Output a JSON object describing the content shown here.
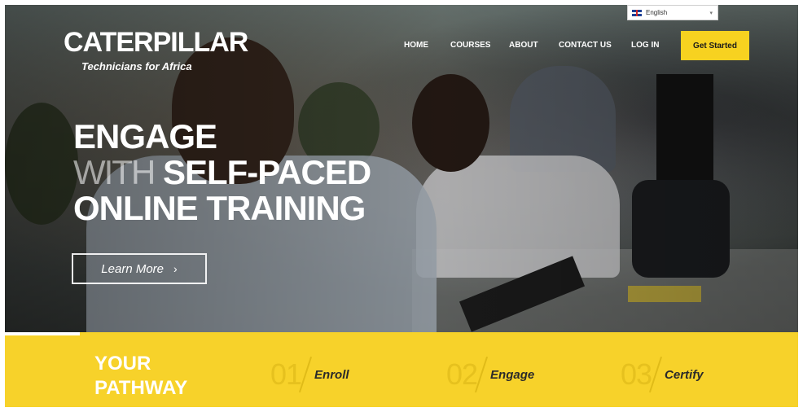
{
  "header": {
    "brand": "CATERPILLAR",
    "tagline": "Technicians for Africa",
    "language": {
      "selected": "English",
      "flag_icon": "uk-flag-icon"
    },
    "nav": [
      {
        "label": "HOME"
      },
      {
        "label": "COURSES"
      },
      {
        "label": "ABOUT"
      },
      {
        "label": "CONTACT US"
      },
      {
        "label": "LOG IN"
      }
    ],
    "cta_label": "Get Started"
  },
  "hero": {
    "line1": "ENGAGE",
    "line2_thin": "WITH",
    "line2_bold": "SELF-PACED",
    "line3": "ONLINE TRAINING",
    "button_label": "Learn More",
    "button_icon": "chevron-right-icon"
  },
  "pathway": {
    "title_line1": "YOUR",
    "title_line2": "PATHWAY",
    "steps": [
      {
        "number": "01",
        "label": "Enroll"
      },
      {
        "number": "02",
        "label": "Engage"
      },
      {
        "number": "03",
        "label": "Certify"
      }
    ]
  },
  "colors": {
    "accent_yellow": "#f7d22a",
    "button_yellow": "#f7d220",
    "text_white": "#ffffff"
  }
}
